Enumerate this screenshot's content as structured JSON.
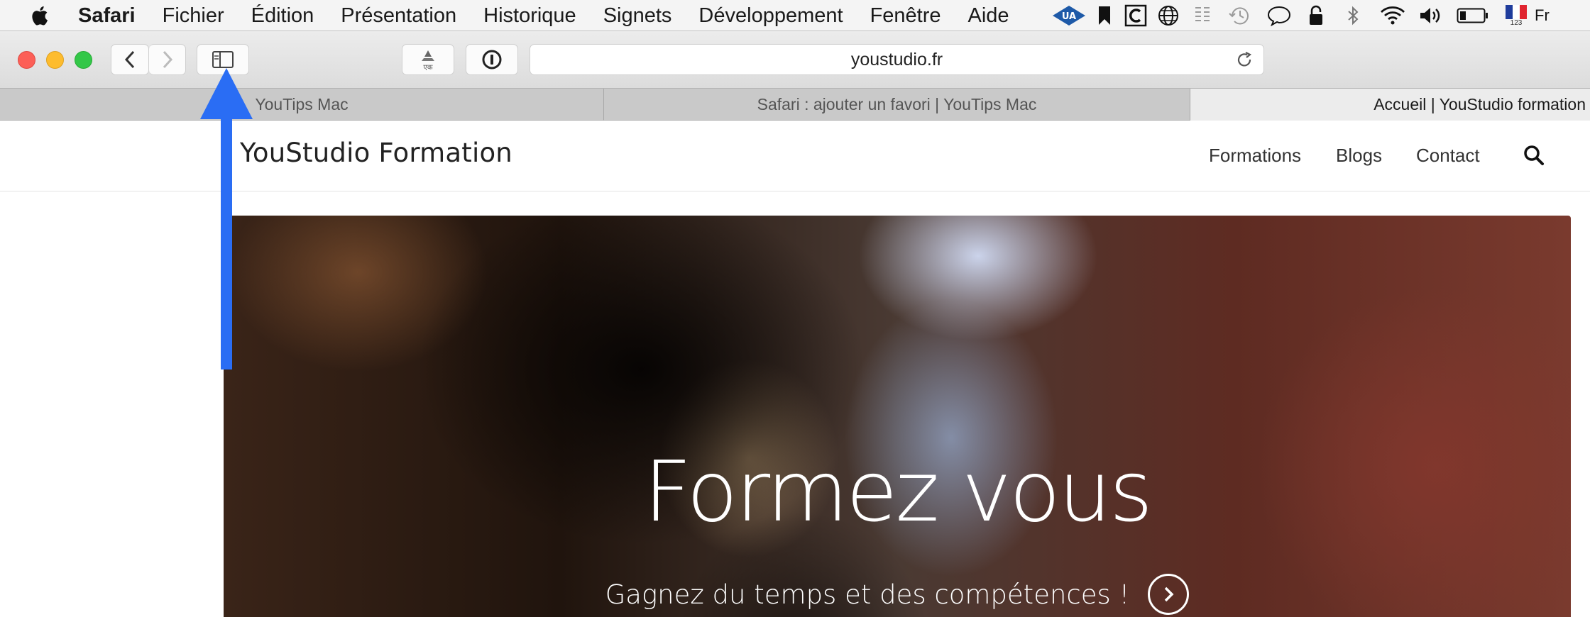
{
  "menubar": {
    "app_name": "Safari",
    "items": [
      "Fichier",
      "Édition",
      "Présentation",
      "Historique",
      "Signets",
      "Développement",
      "Fenêtre",
      "Aide"
    ],
    "input_badge": "123",
    "input_label": "Fr"
  },
  "toolbar": {
    "address": "youstudio.fr"
  },
  "tabs": [
    {
      "title": "YouTips Mac",
      "active": false
    },
    {
      "title": "Safari : ajouter un favori | YouTips Mac",
      "active": false
    },
    {
      "title": "Accueil | YouStudio formation",
      "active": true
    }
  ],
  "site": {
    "brand": "YouStudio Formation",
    "nav": [
      "Formations",
      "Blogs",
      "Contact"
    ],
    "hero_title": "Formez vous",
    "hero_subtitle": "Gagnez du temps et des compétences !"
  },
  "colors": {
    "arrow": "#2a6df4",
    "close": "#fc5f57",
    "minimize": "#fdbc2e",
    "zoom": "#33c748"
  },
  "icons": [
    "apple-icon",
    "sidebar-icon",
    "back-icon",
    "forward-icon",
    "share-icon",
    "1password-icon",
    "reload-icon",
    "search-icon",
    "arrow-right-circle-icon"
  ]
}
